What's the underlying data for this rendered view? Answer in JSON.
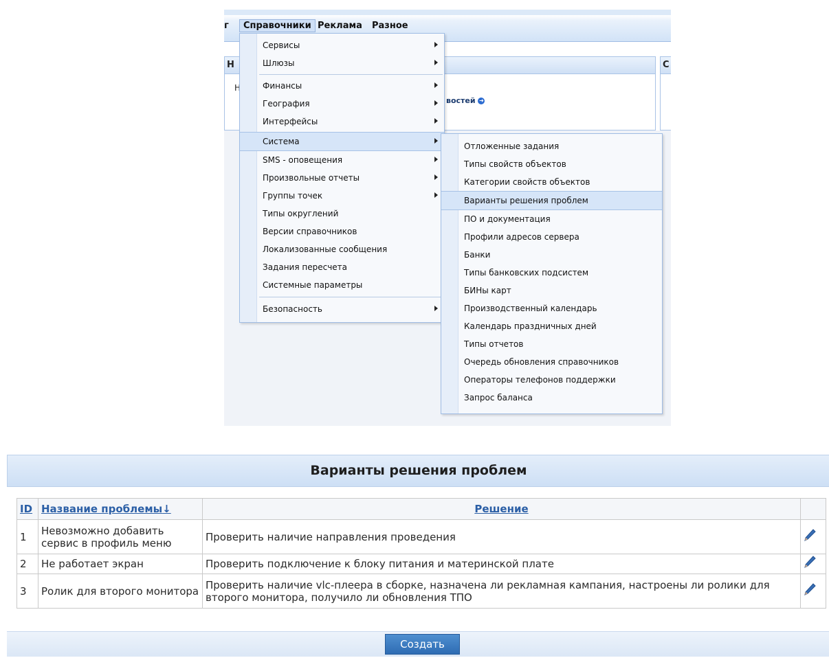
{
  "menubar": {
    "items": [
      "г",
      "Справочники",
      "Реклама",
      "Разное"
    ]
  },
  "background_panels": {
    "left_header": "Н",
    "left_text": "Н",
    "right_header": "С",
    "news_link": "востей"
  },
  "dropdown": {
    "items": [
      {
        "label": "Сервисы",
        "has_submenu": true
      },
      {
        "label": "Шлюзы",
        "has_submenu": true
      },
      {
        "label": "Финансы",
        "has_submenu": true
      },
      {
        "label": "География",
        "has_submenu": true
      },
      {
        "label": "Интерфейсы",
        "has_submenu": true
      },
      {
        "label": "Система",
        "has_submenu": true,
        "highlighted": true
      },
      {
        "label": "SMS - оповещения",
        "has_submenu": true
      },
      {
        "label": "Произвольные отчеты",
        "has_submenu": true
      },
      {
        "label": "Группы точек",
        "has_submenu": true
      },
      {
        "label": "Типы округлений",
        "has_submenu": false
      },
      {
        "label": "Версии справочников",
        "has_submenu": false
      },
      {
        "label": "Локализованные сообщения",
        "has_submenu": false
      },
      {
        "label": "Задания пересчета",
        "has_submenu": false
      },
      {
        "label": "Системные параметры",
        "has_submenu": false
      },
      {
        "label": "Безопасность",
        "has_submenu": true
      }
    ]
  },
  "submenu": {
    "items": [
      "Отложенные задания",
      "Типы свойств объектов",
      "Категории свойств объектов",
      "Варианты решения проблем",
      "ПО и документация",
      "Профили адресов сервера",
      "Банки",
      "Типы банковских подсистем",
      "БИНы карт",
      "Производственный календарь",
      "Календарь праздничных дней",
      "Типы отчетов",
      "Очередь обновления справочников",
      "Операторы телефонов поддержки",
      "Запрос баланса"
    ],
    "highlighted_index": 3
  },
  "problems": {
    "title": "Варианты решения проблем",
    "columns": {
      "id": "ID",
      "name": "Название проблемы",
      "solution": "Решение"
    },
    "rows": [
      {
        "id": "1",
        "name": "Невозможно добавить сервис в профиль меню",
        "solution": "Проверить наличие направления проведения"
      },
      {
        "id": "2",
        "name": "Не работает экран",
        "solution": "Проверить подключение к блоку питания и материнской плате"
      },
      {
        "id": "3",
        "name": "Ролик для второго монитора",
        "solution": "Проверить наличие vlc-плеера в сборке, назначена ли рекламная кампания, настроены ли ролики для второго монитора, получило ли обновления ТПО"
      }
    ],
    "create_label": "Создать"
  },
  "colors": {
    "accent": "#2e6cb3",
    "header_link": "#2b5fa6",
    "menu_highlight": "#d6e5f8"
  }
}
